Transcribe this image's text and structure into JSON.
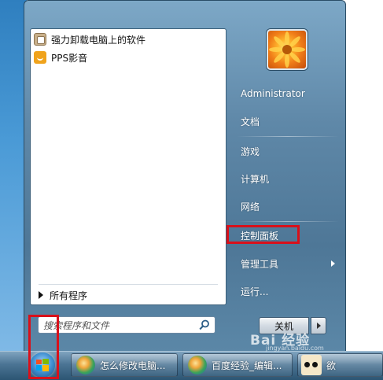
{
  "start_menu": {
    "pinned_programs": [
      {
        "label": "强力卸载电脑上的软件",
        "icon": "uninstall-app-icon"
      },
      {
        "label": "PPS影音",
        "icon": "pps-player-icon"
      }
    ],
    "all_programs_label": "所有程序",
    "search": {
      "placeholder": "搜索程序和文件",
      "value": ""
    },
    "user_name": "Administrator",
    "right_items": [
      {
        "label": "文档"
      },
      {
        "label": "游戏"
      },
      {
        "label": "计算机"
      },
      {
        "label": "网络"
      },
      {
        "label": "控制面板"
      },
      {
        "label": "管理工具"
      },
      {
        "label": "运行..."
      }
    ],
    "shutdown_label": "关机"
  },
  "taskbar": {
    "buttons": [
      {
        "label": "怎么修改电脑...",
        "icon": "ie-browser-icon"
      },
      {
        "label": "百度经验_编辑...",
        "icon": "ie-browser-icon"
      },
      {
        "label": "欲",
        "icon": "avatar-icon"
      }
    ]
  },
  "watermark": {
    "text": "Bai 经验",
    "sub": "jingyan.baidu.com"
  },
  "colors": {
    "highlight": "#d9101a",
    "menu_body": "#5f88a8"
  }
}
